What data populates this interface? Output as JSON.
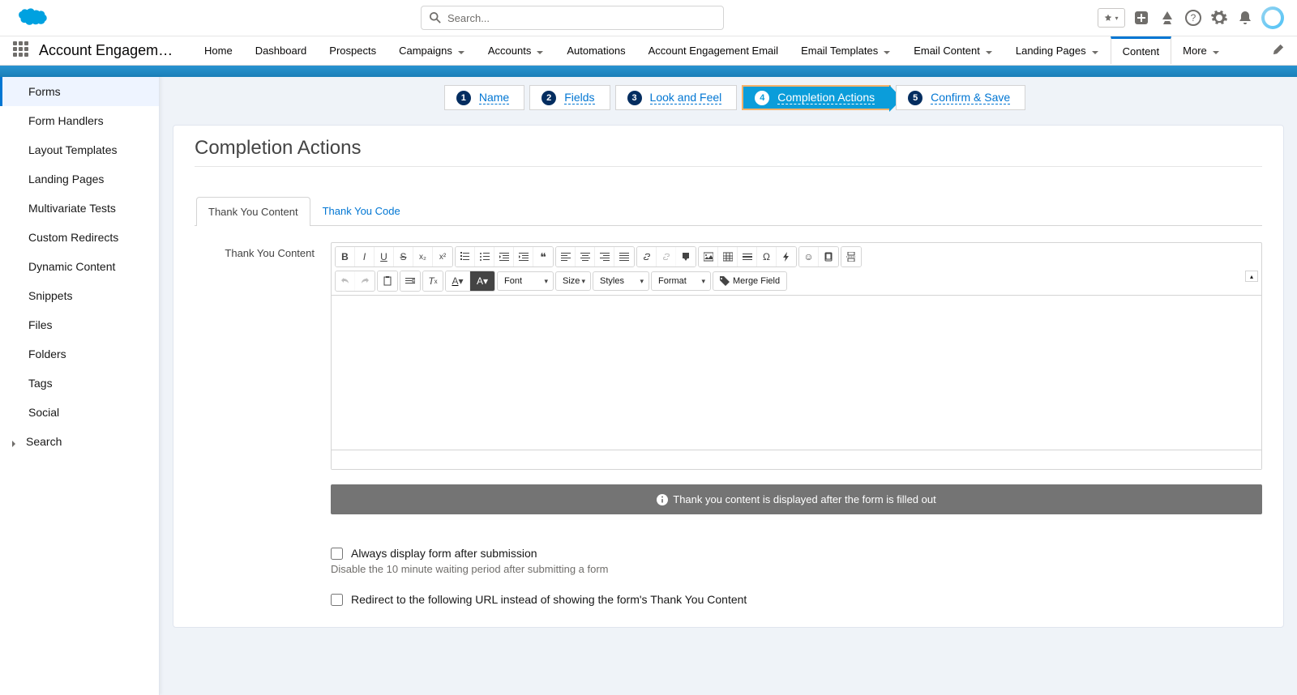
{
  "header": {
    "search_placeholder": "Search..."
  },
  "nav": {
    "app_name": "Account Engageme...",
    "items": [
      {
        "label": "Home",
        "chevron": false
      },
      {
        "label": "Dashboard",
        "chevron": false
      },
      {
        "label": "Prospects",
        "chevron": false
      },
      {
        "label": "Campaigns",
        "chevron": true
      },
      {
        "label": "Accounts",
        "chevron": true
      },
      {
        "label": "Automations",
        "chevron": false
      },
      {
        "label": "Account Engagement Email",
        "chevron": false
      },
      {
        "label": "Email Templates",
        "chevron": true
      },
      {
        "label": "Email Content",
        "chevron": true
      },
      {
        "label": "Landing Pages",
        "chevron": true
      },
      {
        "label": "Content",
        "chevron": false,
        "active": true
      },
      {
        "label": "More",
        "chevron": true
      }
    ]
  },
  "sidebar": {
    "items": [
      {
        "label": "Forms",
        "active": true
      },
      {
        "label": "Form Handlers"
      },
      {
        "label": "Layout Templates"
      },
      {
        "label": "Landing Pages"
      },
      {
        "label": "Multivariate Tests"
      },
      {
        "label": "Custom Redirects"
      },
      {
        "label": "Dynamic Content"
      },
      {
        "label": "Snippets"
      },
      {
        "label": "Files"
      },
      {
        "label": "Folders"
      },
      {
        "label": "Tags"
      },
      {
        "label": "Social"
      },
      {
        "label": "Search",
        "chevron": true
      }
    ]
  },
  "wizard": {
    "steps": [
      {
        "num": "1",
        "label": "Name"
      },
      {
        "num": "2",
        "label": "Fields"
      },
      {
        "num": "3",
        "label": "Look and Feel"
      },
      {
        "num": "4",
        "label": "Completion Actions",
        "active": true
      },
      {
        "num": "5",
        "label": "Confirm & Save"
      }
    ]
  },
  "page": {
    "title": "Completion Actions",
    "tabs": [
      {
        "label": "Thank You Content",
        "active": true
      },
      {
        "label": "Thank You Code"
      }
    ],
    "form_label": "Thank You Content",
    "toolbar": {
      "font": "Font",
      "size": "Size",
      "styles": "Styles",
      "format": "Format",
      "merge": "Merge Field"
    },
    "info_text": "Thank you content is displayed after the form is filled out",
    "checkbox1_label": "Always display form after submission",
    "checkbox1_help": "Disable the 10 minute waiting period after submitting a form",
    "checkbox2_label": "Redirect to the following URL instead of showing the form's Thank You Content"
  }
}
